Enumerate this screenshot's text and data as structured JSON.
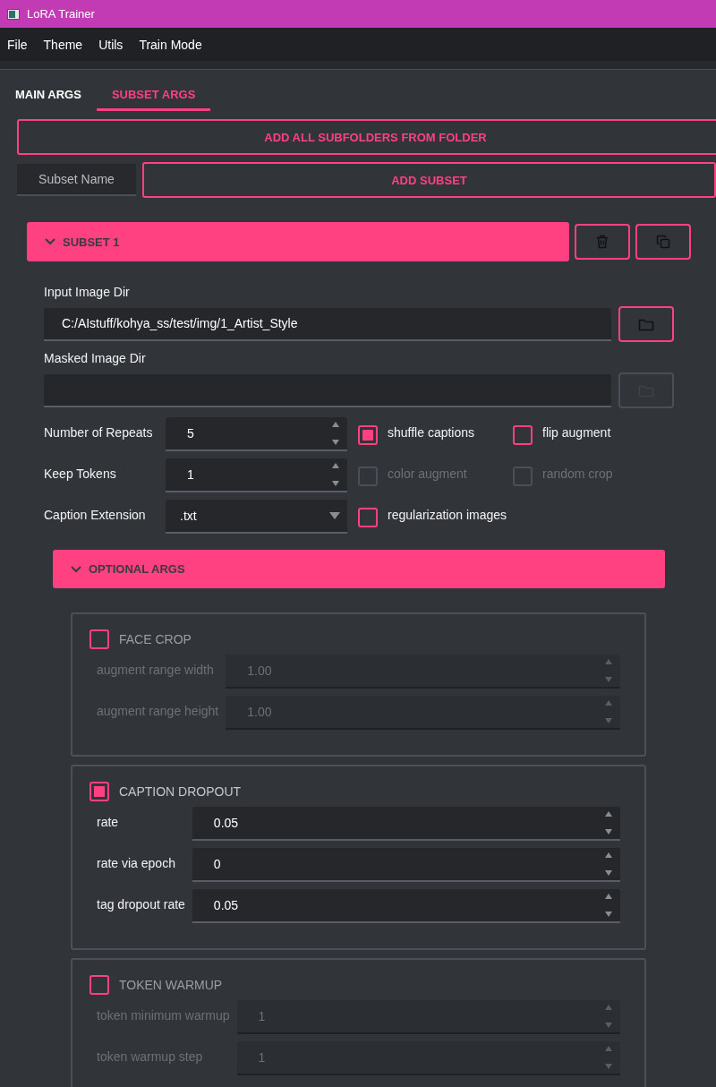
{
  "window": {
    "title": "LoRA Trainer"
  },
  "menu": [
    "File",
    "Theme",
    "Utils",
    "Train Mode"
  ],
  "tabs": [
    {
      "label": "MAIN ARGS",
      "selected": false
    },
    {
      "label": "SUBSET ARGS",
      "selected": true
    }
  ],
  "add_folder_button": "ADD ALL SUBFOLDERS FROM FOLDER",
  "subset_name_field": {
    "placeholder": "Subset Name"
  },
  "add_subset_button": "ADD SUBSET",
  "subset": {
    "title": "SUBSET 1",
    "expanded": true,
    "dirs": [
      {
        "label": "Input Image Dir",
        "value": "C:/AIstuff/kohya_ss/test/img/1_Artist_Style",
        "browse_disabled": false
      },
      {
        "label": "Masked Image Dir",
        "browse_disabled": true
      }
    ],
    "settings": [
      {
        "kind": "spin",
        "label": "Number of Repeats",
        "value": "5"
      },
      {
        "kind": "spin",
        "label": "Keep Tokens",
        "value": "1"
      },
      {
        "kind": "select",
        "label": "Caption Extension",
        "value": ".txt"
      }
    ],
    "checkboxes": [
      {
        "label": "shuffle captions",
        "checked": true,
        "disabled": false
      },
      {
        "label": "flip augment",
        "checked": false,
        "disabled": false
      },
      {
        "label": "color augment",
        "checked": false,
        "disabled": true
      },
      {
        "label": "random crop",
        "checked": false,
        "disabled": true
      },
      {
        "label": "regularization images",
        "checked": false,
        "disabled": false
      }
    ],
    "optional_args": {
      "title": "OPTIONAL ARGS",
      "expanded": true,
      "groups": [
        {
          "title": "FACE CROP",
          "checked": false,
          "fields": [
            {
              "label": "augment range width",
              "value": "1.00"
            },
            {
              "label": "augment range height",
              "value": "1.00"
            }
          ]
        },
        {
          "title": "CAPTION DROPOUT",
          "checked": true,
          "fields": [
            {
              "label": "rate",
              "value": "0.05"
            },
            {
              "label": "rate via epoch",
              "value": "0"
            },
            {
              "label": "tag dropout rate",
              "value": "0.05"
            }
          ]
        },
        {
          "title": "TOKEN WARMUP",
          "checked": false,
          "fields": [
            {
              "label": "token minimum warmup",
              "value": "1"
            },
            {
              "label": "token warmup step",
              "value": "1"
            }
          ]
        }
      ]
    }
  }
}
